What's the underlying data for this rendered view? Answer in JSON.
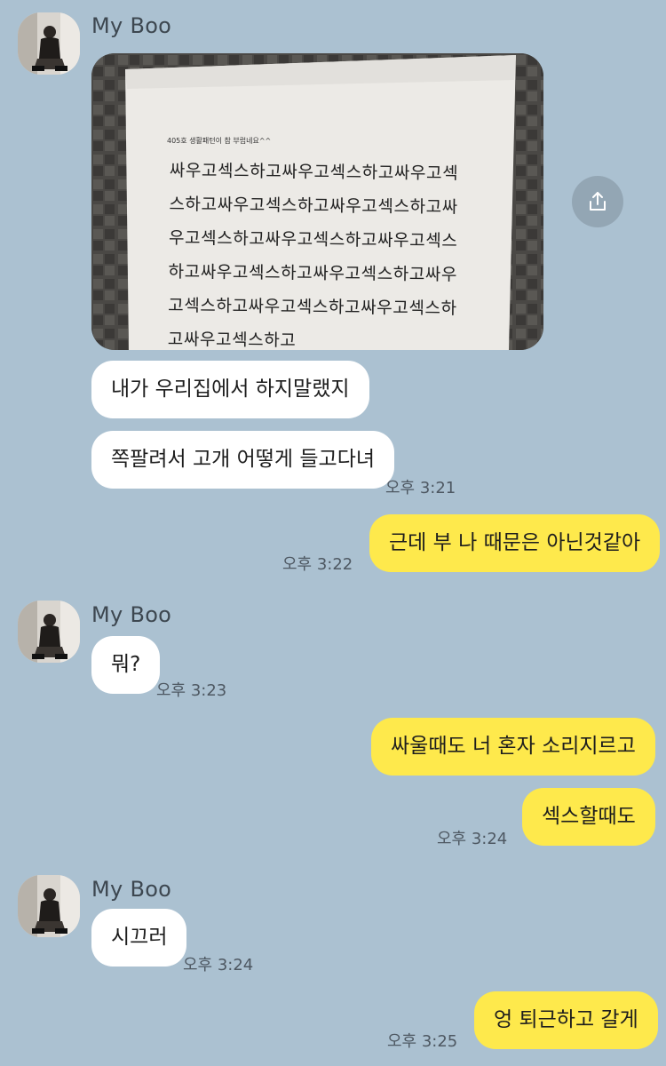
{
  "contact_name": "My Boo",
  "photo": {
    "caption": "405호 생활패턴이 참 부럽네요^^",
    "lines": [
      "싸우고섹스하고싸우고섹스하고싸우고섹",
      "스하고싸우고섹스하고싸우고섹스하고싸",
      "우고섹스하고싸우고섹스하고싸우고섹스",
      "하고싸우고섹스하고싸우고섹스하고싸우",
      "고섹스하고싸우고섹스하고싸우고섹스하",
      "고싸우고섹스하고"
    ]
  },
  "messages": {
    "m1": "내가 우리집에서 하지말랬지",
    "m2": "쪽팔려서 고개 어떻게 들고다녀",
    "t1": "오후 3:21",
    "m3": "근데 부 나 때문은 아닌것같아",
    "t2": "오후 3:22",
    "m4": "뭐?",
    "t3": "오후 3:23",
    "m5": "싸울때도 너 혼자 소리지르고",
    "m6": "섹스할때도",
    "t4": "오후 3:24",
    "m7": "시끄러",
    "t5": "오후 3:24",
    "m8": "엉 퇴근하고 갈게",
    "t6": "오후 3:25"
  },
  "icons": {
    "share": "share-icon",
    "avatar": "profile-photo"
  },
  "colors": {
    "background": "#abc1d1",
    "incoming_bubble": "#ffffff",
    "outgoing_bubble": "#fee94c"
  }
}
